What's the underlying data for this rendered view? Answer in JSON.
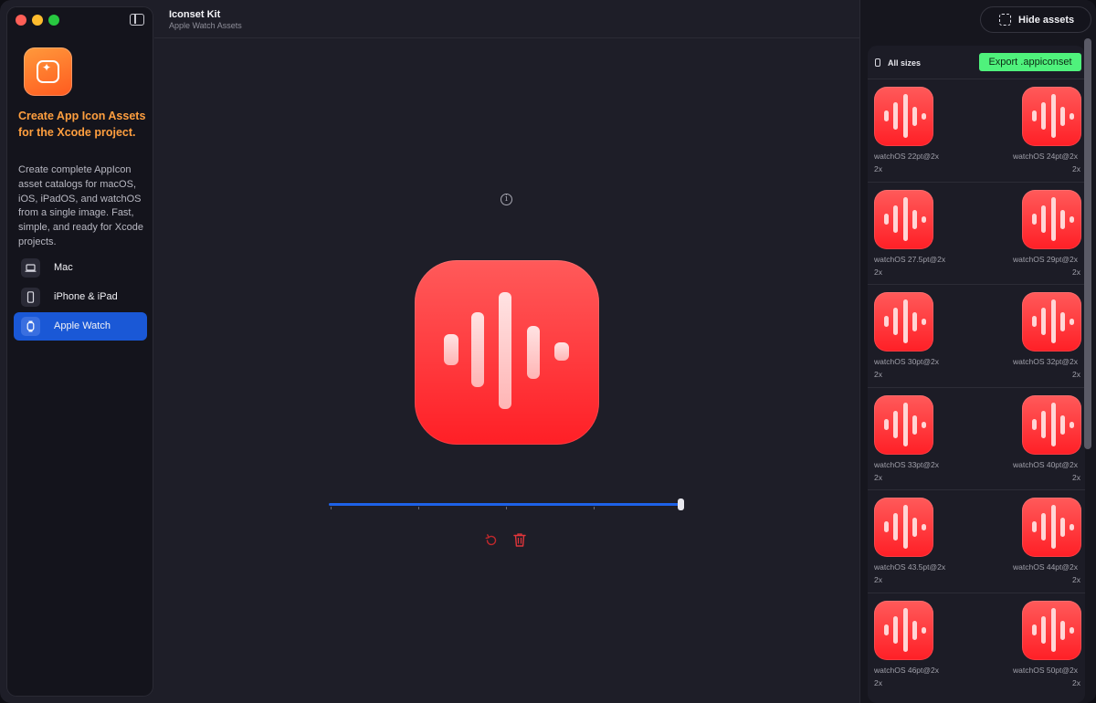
{
  "header": {
    "title": "Iconset Kit",
    "subtitle": "Apple Watch Assets"
  },
  "sidebar": {
    "promo_title": "Create App Icon Assets for the Xcode project.",
    "promo_body": "Create complete AppIcon asset catalogs for macOS, iOS, iPadOS, and watchOS from a single image. Fast, simple, and ready for Xcode projects.",
    "items": [
      {
        "label": "Mac",
        "icon": "laptop-icon"
      },
      {
        "label": "iPhone & iPad",
        "icon": "phone-icon"
      },
      {
        "label": "Apple Watch",
        "icon": "watch-icon",
        "active": true
      }
    ]
  },
  "toolbar": {
    "hide_assets_label": "Hide assets"
  },
  "assets": {
    "filter_label": "All sizes",
    "export_label": "Export .appiconset",
    "items": [
      {
        "label": "watchOS 22pt@2x",
        "scale": "2x"
      },
      {
        "label": "watchOS 24pt@2x",
        "scale": "2x"
      },
      {
        "label": "watchOS 27.5pt@2x",
        "scale": "2x"
      },
      {
        "label": "watchOS 29pt@2x",
        "scale": "2x"
      },
      {
        "label": "watchOS 30pt@2x",
        "scale": "2x"
      },
      {
        "label": "watchOS 32pt@2x",
        "scale": "2x"
      },
      {
        "label": "watchOS 33pt@2x",
        "scale": "2x"
      },
      {
        "label": "watchOS 40pt@2x",
        "scale": "2x"
      },
      {
        "label": "watchOS 43.5pt@2x",
        "scale": "2x"
      },
      {
        "label": "watchOS 44pt@2x",
        "scale": "2x"
      },
      {
        "label": "watchOS 46pt@2x",
        "scale": "2x"
      },
      {
        "label": "watchOS 50pt@2x",
        "scale": "2x"
      }
    ]
  },
  "colors": {
    "accent": "#1a58d6",
    "promo": "#ff9f3f",
    "export": "#4ff27c",
    "icon_red": "#ff2b2f"
  }
}
